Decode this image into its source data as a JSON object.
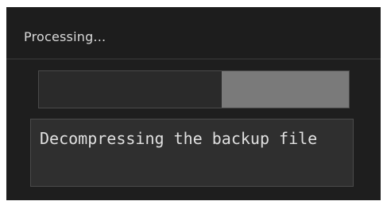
{
  "dialog": {
    "title": "Processing...",
    "progress": 0.41,
    "status_text": "Decompressing the backup file"
  },
  "colors": {
    "dialog_bg": "#1e1e1e",
    "progress_fill": "#7a7a7a",
    "text": "#e0e0e0"
  }
}
